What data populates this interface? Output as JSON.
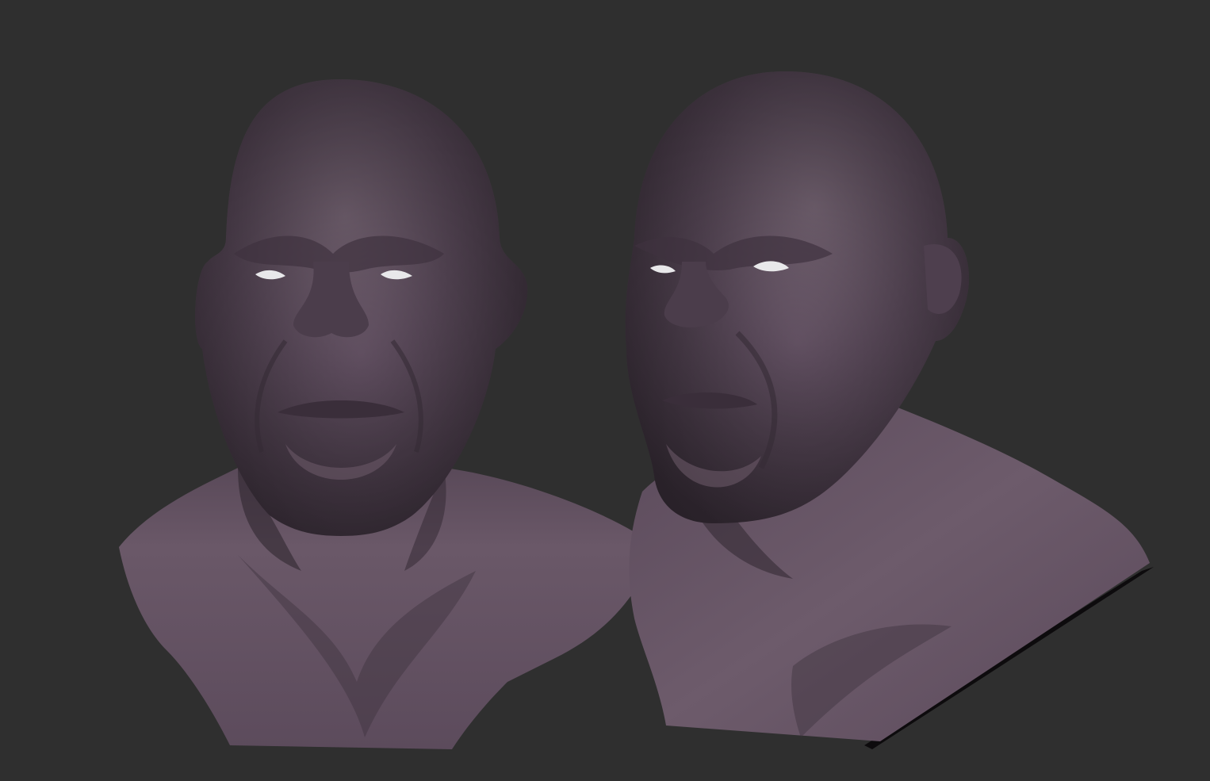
{
  "viewport": {
    "background": "#2f2f2f",
    "material_color": "#5a4a5a",
    "eye_color": "#e8e8ea"
  },
  "models": [
    {
      "name": "bust-front-view",
      "view": "front"
    },
    {
      "name": "bust-three-quarter-view",
      "view": "three-quarter"
    }
  ]
}
